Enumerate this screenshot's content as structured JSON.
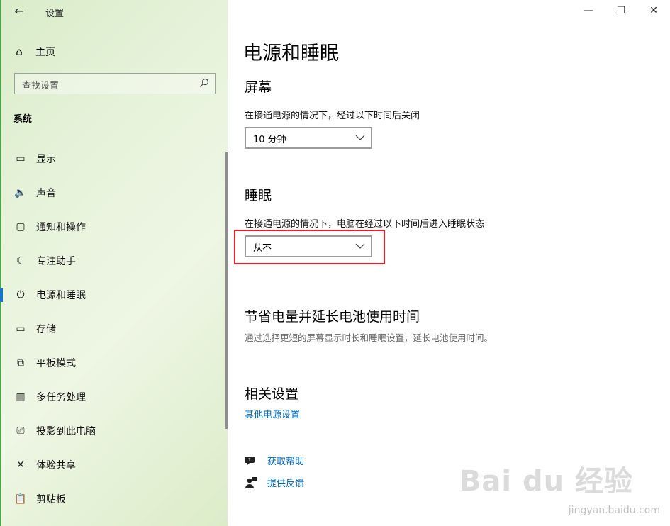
{
  "app": {
    "title": "设置",
    "back_icon": "back-arrow-icon"
  },
  "window_controls": {
    "minimize": "—",
    "maximize": "☐",
    "close": "✕"
  },
  "sidebar": {
    "home_label": "主页",
    "search_placeholder": "查找设置",
    "section_title": "系统",
    "items": [
      {
        "label": "显示",
        "icon": "monitor-icon",
        "glyph": "▭"
      },
      {
        "label": "声音",
        "icon": "speaker-icon",
        "glyph": "🔈"
      },
      {
        "label": "通知和操作",
        "icon": "notification-icon",
        "glyph": "▢"
      },
      {
        "label": "专注助手",
        "icon": "moon-icon",
        "glyph": "☾"
      },
      {
        "label": "电源和睡眠",
        "icon": "power-icon",
        "glyph": "⏻"
      },
      {
        "label": "存储",
        "icon": "storage-icon",
        "glyph": "▭"
      },
      {
        "label": "平板模式",
        "icon": "tablet-mode-icon",
        "glyph": "⧉"
      },
      {
        "label": "多任务处理",
        "icon": "multitask-icon",
        "glyph": "▥"
      },
      {
        "label": "投影到此电脑",
        "icon": "project-icon",
        "glyph": "⎚"
      },
      {
        "label": "体验共享",
        "icon": "share-icon",
        "glyph": "✕"
      },
      {
        "label": "剪贴板",
        "icon": "clipboard-icon",
        "glyph": "📋"
      }
    ],
    "active_index": 4
  },
  "main": {
    "title": "电源和睡眠",
    "screen": {
      "heading": "屏幕",
      "description": "在接通电源的情况下，经过以下时间后关闭",
      "value": "10 分钟"
    },
    "sleep": {
      "heading": "睡眠",
      "description": "在接通电源的情况下，电脑在经过以下时间后进入睡眠状态",
      "value": "从不"
    },
    "battery": {
      "heading": "节省电量并延长电池使用时间",
      "description": "通过选择更短的屏幕显示时长和睡眠设置，延长电池使用时间。"
    },
    "related": {
      "heading": "相关设置",
      "link": "其他电源设置"
    },
    "help": {
      "get_help": "获取帮助",
      "feedback": "提供反馈"
    }
  },
  "watermark": {
    "logo": "Bai du 经验",
    "url": "jingyan.baidu.com"
  },
  "colors": {
    "accent": "#0067b8",
    "highlight": "#e0202a",
    "active_indicator": "#1a73c9"
  }
}
